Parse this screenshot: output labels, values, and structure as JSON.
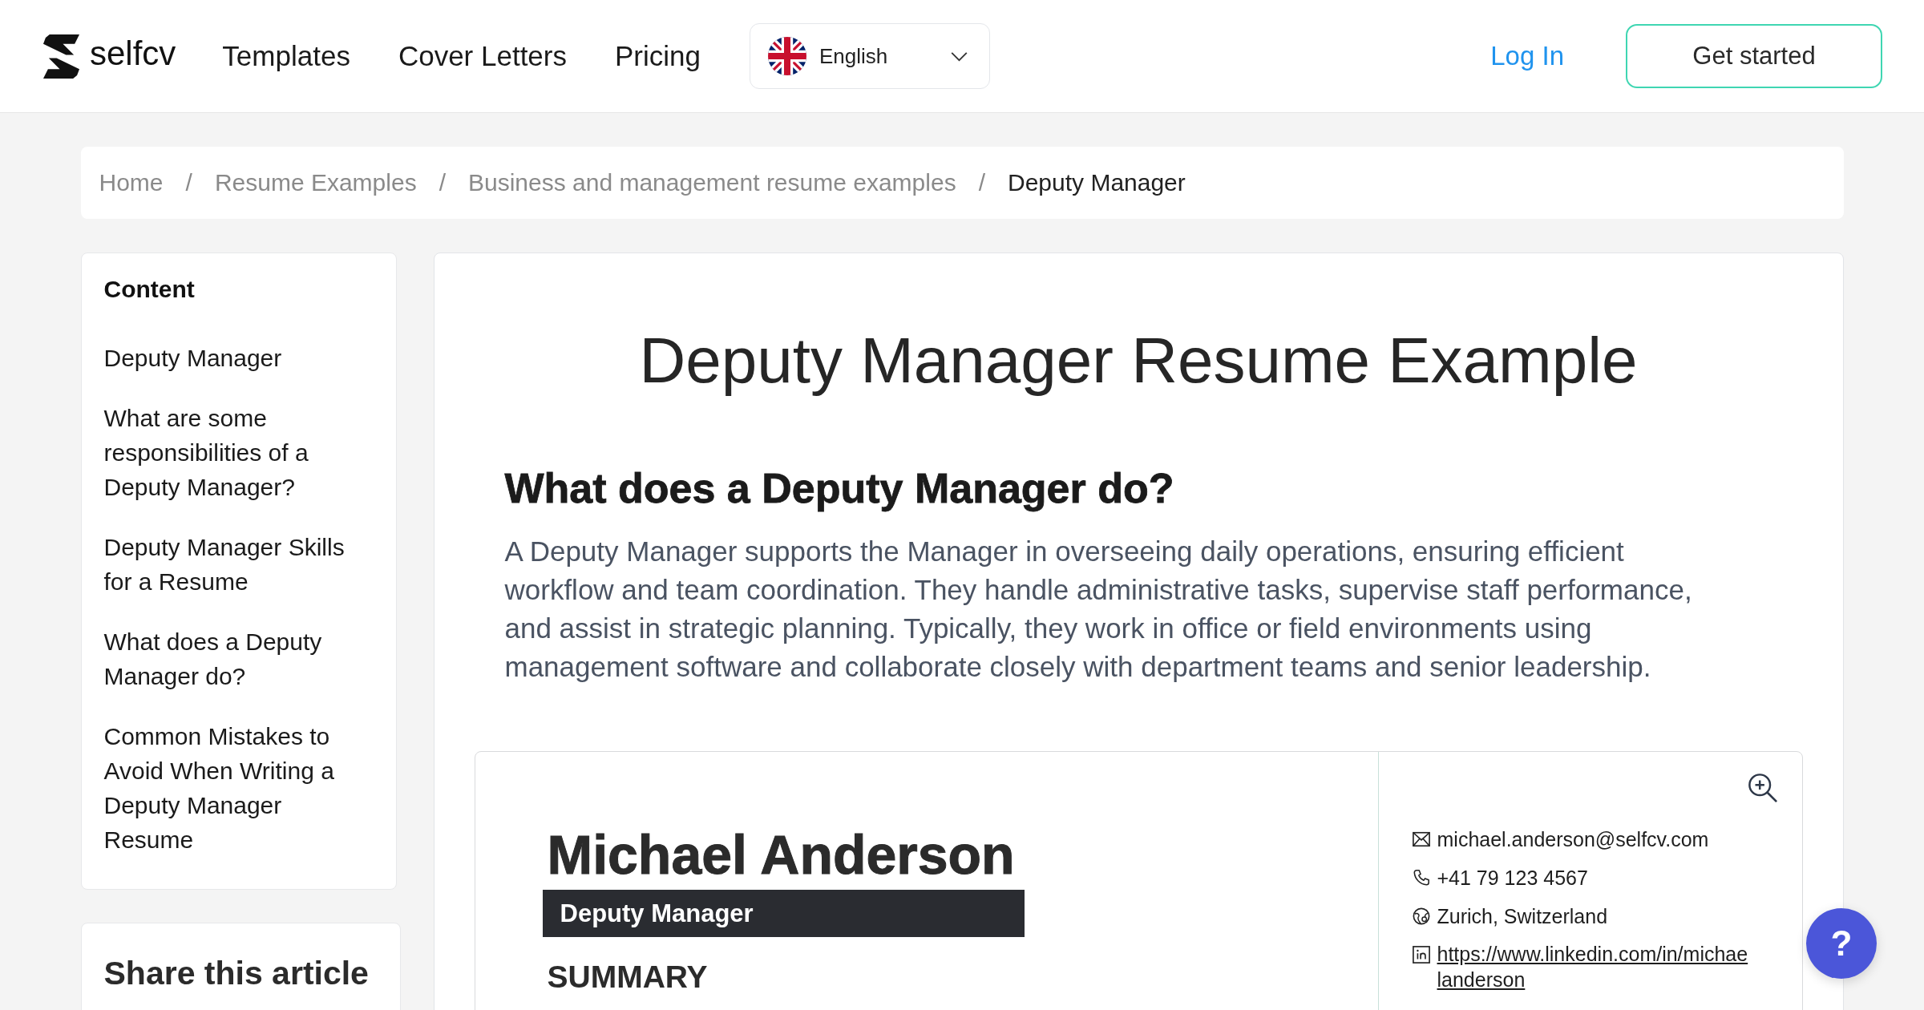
{
  "header": {
    "logo": {
      "text": "selfcv"
    },
    "nav": [
      {
        "label": "Templates"
      },
      {
        "label": "Cover Letters"
      },
      {
        "label": "Pricing"
      }
    ],
    "language": {
      "label": "English"
    },
    "login": {
      "label": "Log In"
    },
    "cta": {
      "label": "Get started"
    }
  },
  "breadcrumb": {
    "separator": "/",
    "items": [
      {
        "label": "Home",
        "current": false
      },
      {
        "label": "Resume Examples",
        "current": false
      },
      {
        "label": "Business and management resume examples",
        "current": false
      },
      {
        "label": "Deputy Manager",
        "current": true
      }
    ]
  },
  "sidebar": {
    "title": "Content",
    "items": [
      {
        "label": "Deputy Manager"
      },
      {
        "label": "What are some responsibilities of a Deputy Manager?"
      },
      {
        "label": "Deputy Manager Skills for a Resume"
      },
      {
        "label": "What does a Deputy Manager do?"
      },
      {
        "label": "Common Mistakes to Avoid When Writing a Deputy Manager Resume"
      }
    ]
  },
  "share": {
    "title": "Share this article"
  },
  "article": {
    "title": "Deputy Manager Resume Example",
    "heading": "What does a Deputy Manager do?",
    "paragraph": "A Deputy Manager supports the Manager in overseeing daily operations, ensuring efficient workflow and team coordination. They handle administrative tasks, supervise staff performance, and assist in strategic planning. Typically, they work in office or field environments using management software and collaborate closely with department teams and senior leadership.",
    "resume_preview": {
      "name": "Michael Anderson",
      "job_title": "Deputy Manager",
      "section": "SUMMARY",
      "contacts": [
        {
          "kind": "email",
          "text": "michael.anderson@selfcv.com"
        },
        {
          "kind": "phone",
          "text": "+41 79 123 4567"
        },
        {
          "kind": "location",
          "text": "Zurich, Switzerland"
        },
        {
          "kind": "linkedin",
          "text": "https://www.linkedin.com/in/michaelanderson"
        }
      ]
    }
  },
  "help_button": {
    "label": "?"
  }
}
